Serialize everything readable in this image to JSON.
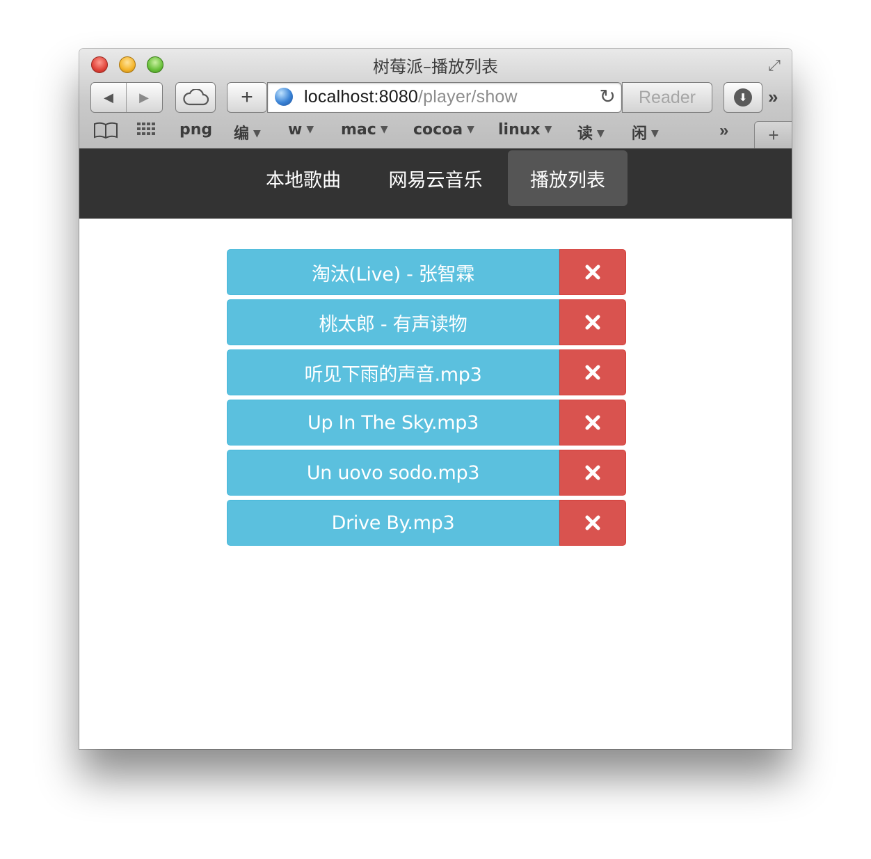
{
  "window": {
    "title": "树莓派–播放列表"
  },
  "toolbar": {
    "url_host": "localhost:8080",
    "url_path": "/player/show",
    "reader_label": "Reader"
  },
  "bookmarks": [
    {
      "label": "png",
      "dropdown": false
    },
    {
      "label": "编",
      "dropdown": true
    },
    {
      "label": "w",
      "dropdown": true
    },
    {
      "label": "mac",
      "dropdown": true
    },
    {
      "label": "cocoa",
      "dropdown": true
    },
    {
      "label": "linux",
      "dropdown": true
    },
    {
      "label": "读",
      "dropdown": true
    },
    {
      "label": "闲",
      "dropdown": true
    }
  ],
  "nav": {
    "tabs": [
      {
        "label": "本地歌曲",
        "active": false
      },
      {
        "label": "网易云音乐",
        "active": false
      },
      {
        "label": "播放列表",
        "active": true
      }
    ]
  },
  "playlist": {
    "items": [
      {
        "title": "淘汰(Live) - 张智霖"
      },
      {
        "title": "桃太郎 - 有声读物"
      },
      {
        "title": "听见下雨的声音.mp3"
      },
      {
        "title": "Up In The Sky.mp3"
      },
      {
        "title": "Un uovo sodo.mp3"
      },
      {
        "title": "Drive By.mp3"
      }
    ],
    "delete_icon": "close-icon"
  },
  "colors": {
    "navbar": "#333333",
    "active_tab": "#555555",
    "song_button": "#5bc0de",
    "delete_button": "#d9534f"
  }
}
